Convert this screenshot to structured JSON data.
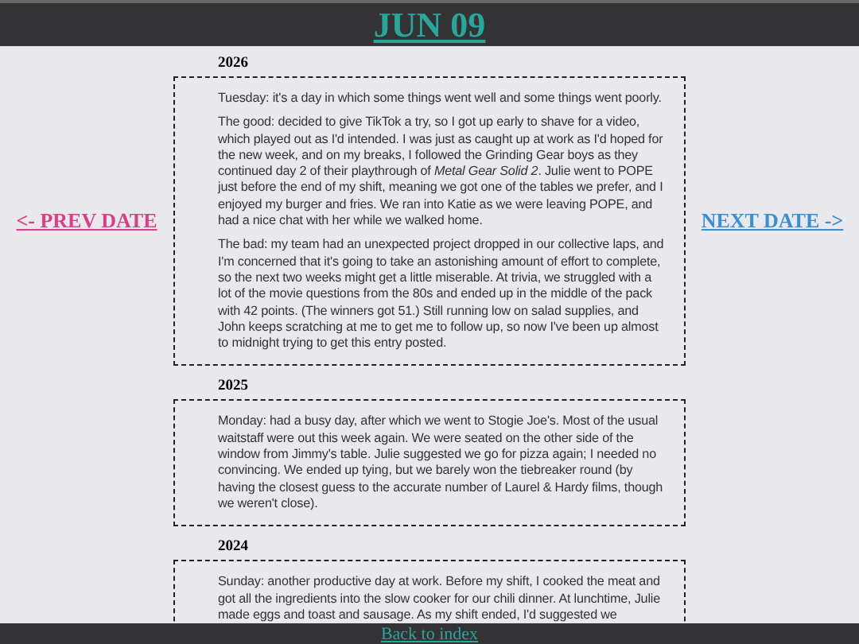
{
  "header": {
    "title": "JUN 09"
  },
  "nav": {
    "prev": "<- PREV DATE",
    "next": "NEXT DATE ->"
  },
  "entries": [
    {
      "year": "2026",
      "paragraphs": [
        "Tuesday: it's a day in which some things went well and some things went poorly.",
        "The good: decided to give TikTok a try, so I got up early to shave for a video, which played out as I'd intended. I was just as caught up at work as I'd hoped for the new week, and on my breaks, I followed the Grinding Gear boys as they continued day 2 of their playthrough of *Metal Gear Solid 2*. Julie went to POPE just before the end of my shift, meaning we got one of the tables we prefer, and I enjoyed my burger and fries. We ran into Katie as we were leaving POPE, and had a nice chat with her while we walked home.",
        "The bad: my team had an unexpected project dropped in our collective laps, and I'm concerned that it's going to take an astonishing amount of effort to complete, so the next two weeks might get a little miserable. At trivia, we struggled with a lot of the movie questions from the 80s and ended up in the middle of the pack with 42 points. (The winners got 51.) Still running low on salad supplies, and John keeps scratching at me to get me to follow up, so now I've been up almost to midnight trying to get this entry posted."
      ]
    },
    {
      "year": "2025",
      "paragraphs": [
        "Monday: had a busy day, after which we went to Stogie Joe's. Most of the usual waitstaff were out this week again. We were seated on the other side of the window from Jimmy's table. Julie suggested we go for pizza again; I needed no convincing. We ended up tying, but we barely won the tiebreaker round (by having the closest guess to the accurate number of Laurel & Hardy films, though we weren't close)."
      ]
    },
    {
      "year": "2024",
      "paragraphs": [
        "Sunday: another productive day at work. Before my shift, I cooked the meat and got all the ingredients into the slow cooker for our chili dinner. At lunchtime, Julie made eggs and toast and sausage. As my shift ended, I'd suggested we"
      ]
    }
  ],
  "footer": {
    "link": "Back to index"
  }
}
